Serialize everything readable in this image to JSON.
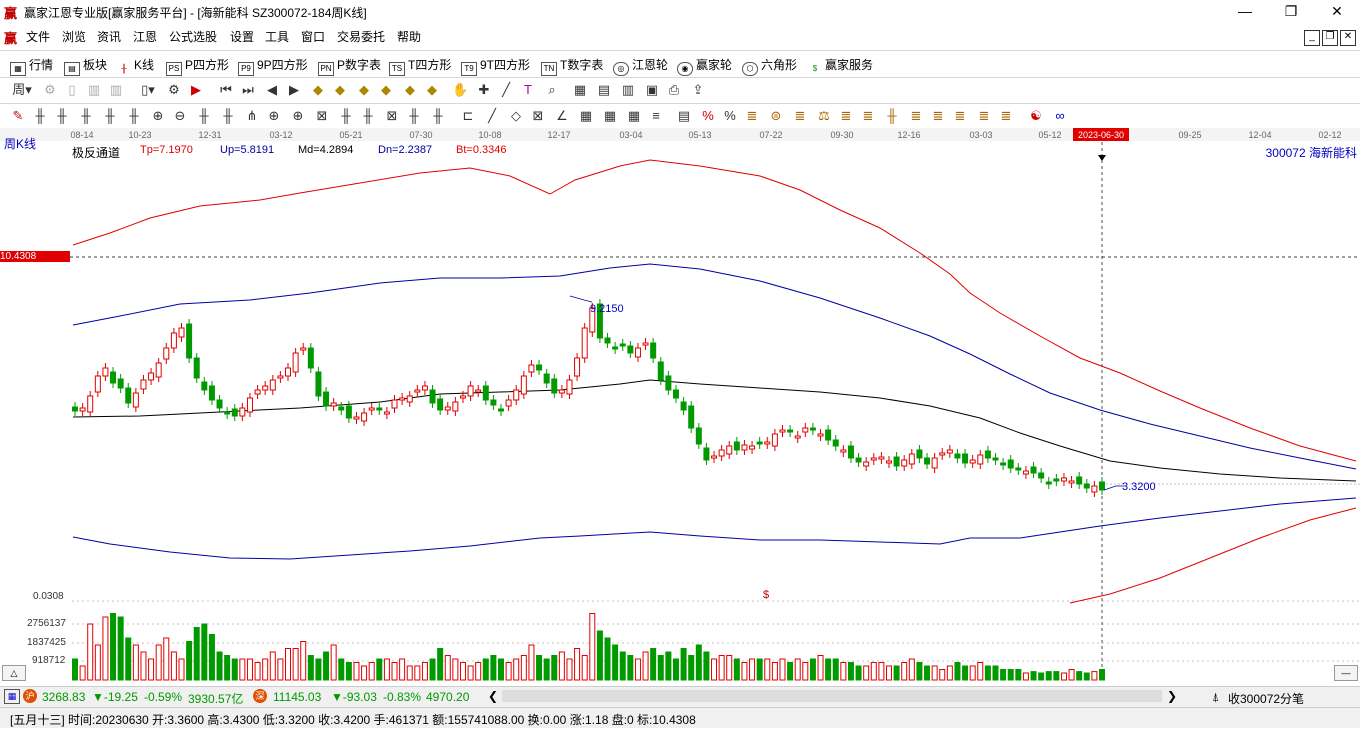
{
  "window": {
    "title": "赢家江恩专业版[赢家服务平台] - [海新能科  SZ300072-184周K线]",
    "app_logo": "赢",
    "minimize": "—",
    "restore": "❐",
    "close": "✕"
  },
  "menu": {
    "logo": "赢",
    "items": [
      "文件",
      "浏览",
      "资讯",
      "江恩",
      "公式选股",
      "设置",
      "工具",
      "窗口",
      "交易委托",
      "帮助"
    ],
    "mdi_controls": [
      "_",
      "❐",
      "✕"
    ]
  },
  "toolbar1": {
    "items": [
      {
        "icon": "grid",
        "label": "行情"
      },
      {
        "icon": "blocks",
        "label": "板块"
      },
      {
        "icon": "candles",
        "label": "K线"
      },
      {
        "icon": "PS",
        "label": "P四方形"
      },
      {
        "icon": "P9",
        "label": "9P四方形"
      },
      {
        "icon": "PN",
        "label": "P数字表"
      },
      {
        "icon": "TS",
        "label": "T四方形"
      },
      {
        "icon": "T9",
        "label": "9T四方形"
      },
      {
        "icon": "TN",
        "label": "T数字表"
      },
      {
        "icon": "wheel",
        "label": "江恩轮"
      },
      {
        "icon": "wheel2",
        "label": "赢家轮"
      },
      {
        "icon": "hexagon",
        "label": "六角形"
      },
      {
        "icon": "dollar",
        "label": "赢家服务"
      }
    ]
  },
  "chart": {
    "period_label": "周K线",
    "indicator_name": "极反通道",
    "params": {
      "tp": "Tp=7.1970",
      "up": "Up=5.8191",
      "md": "Md=4.2894",
      "dn": "Dn=2.2387",
      "bt": "Bt=0.3346"
    },
    "stock_label": "300072  海新能科",
    "date_axis": [
      "08-14",
      "10-23",
      "12-31",
      "03-12",
      "05-21",
      "07-30",
      "10-08",
      "12-17",
      "03-04",
      "05-13",
      "07-22",
      "09-30",
      "12-16",
      "03-03",
      "05-12",
      "2023-06-30",
      "09-25",
      "12-04",
      "02-12"
    ],
    "selected_date": "2023-06-30",
    "price_marker": "10.4308",
    "high_label": "9.2150",
    "low_label": "3.3200",
    "volume_axis": [
      "0.0308",
      "2756137",
      "1837425",
      "918712"
    ],
    "volume_marker": "$",
    "colors": {
      "up": "#e00000",
      "down": "#009a00",
      "channel_outer": "#e00000",
      "channel_inner": "#0000a0",
      "mid": "#000000",
      "label_blue": "#0000c0"
    }
  },
  "statusbar": {
    "sh_index": "3268.83",
    "sh_change": "▼-19.25",
    "sh_pct": "-0.59%",
    "sh_amount": "3930.57亿",
    "sz_index": "11145.03",
    "sz_change": "▼-93.03",
    "sz_pct": "-0.83%",
    "sz_amount": "4970.20",
    "right_label": "收300072分笔"
  },
  "infobar": {
    "text": "[五月十三] 时间:20230630 开:3.3600 高:3.4300 低:3.3200 收:3.4200 手:461371 额:155741088.00 换:0.00 涨:1.18 盘:0 标:10.4308"
  }
}
